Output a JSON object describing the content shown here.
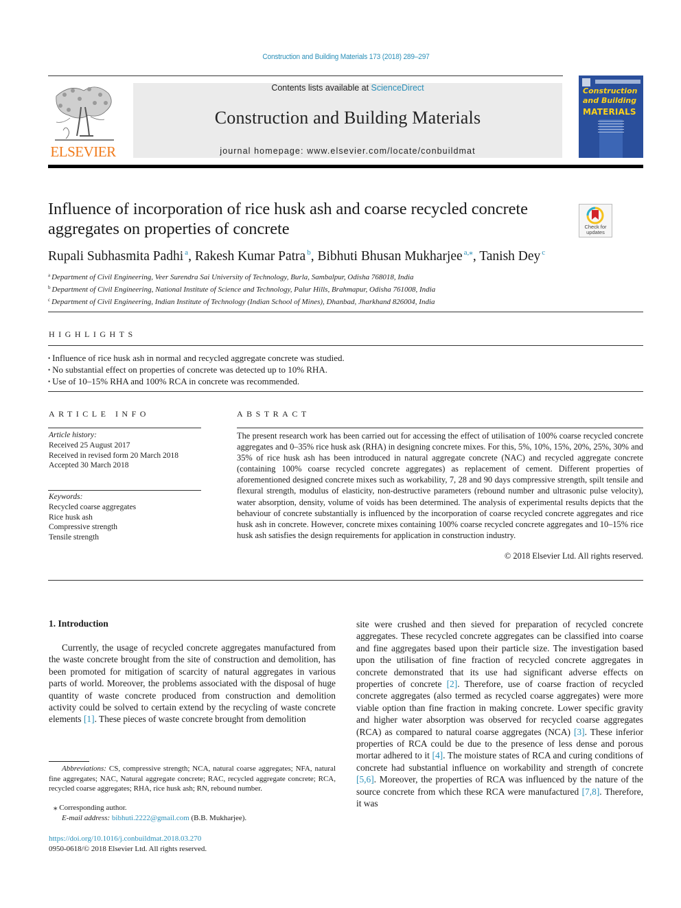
{
  "header": {
    "journal_ref": "Construction and Building Materials 173 (2018) 289–297",
    "contents_prefix": "Contents lists available at ",
    "sciencedirect_link": "ScienceDirect",
    "journal_title": "Construction and Building Materials",
    "homepage_prefix": "journal homepage: ",
    "homepage_url": "www.elsevier.com/locate/conbuildmat",
    "publisher": "ELSEVIER",
    "cover": {
      "line1": "Construction",
      "line2": "and Building",
      "line3": "MATERIALS"
    },
    "colors": {
      "link": "#2a8fb8",
      "elsevier_orange": "#f07a1a",
      "cover_blue": "#2a4f9c",
      "cover_yellow": "#ffd21a"
    }
  },
  "article": {
    "title_line1": "Influence of incorporation of rice husk ash and coarse recycled concrete",
    "title_line2": "aggregates on properties of concrete",
    "check_updates": {
      "line1": "Check for",
      "line2": "updates"
    },
    "authors": [
      {
        "name": "Rupali Subhasmita Padhi",
        "sup": "a"
      },
      {
        "name": "Rakesh Kumar Patra",
        "sup": "b"
      },
      {
        "name": "Bibhuti Bhusan Mukharjee",
        "sup": "a,⁎"
      },
      {
        "name": "Tanish Dey",
        "sup": "c"
      }
    ],
    "affiliations": [
      {
        "key": "a",
        "text": "Department of Civil Engineering, Veer Surendra Sai University of Technology, Burla, Sambalpur, Odisha 768018, India"
      },
      {
        "key": "b",
        "text": "Department of Civil Engineering, National Institute of Science and Technology, Palur Hills, Brahmapur, Odisha 761008, India"
      },
      {
        "key": "c",
        "text": "Department of Civil Engineering, Indian Institute of Technology (Indian School of Mines), Dhanbad, Jharkhand 826004, India"
      }
    ]
  },
  "highlights": {
    "heading": "HIGHLIGHTS",
    "items": [
      "Influence of rice husk ash in normal and recycled aggregate concrete was studied.",
      "No substantial effect on properties of concrete was detected up to 10% RHA.",
      "Use of 10–15% RHA and 100% RCA in concrete was recommended."
    ]
  },
  "article_info": {
    "heading": "ARTICLE INFO",
    "history_label": "Article history:",
    "history": [
      "Received 25 August 2017",
      "Received in revised form 20 March 2018",
      "Accepted 30 March 2018"
    ],
    "keywords_label": "Keywords:",
    "keywords": [
      "Recycled coarse aggregates",
      "Rice husk ash",
      "Compressive strength",
      "Tensile strength"
    ]
  },
  "abstract": {
    "heading": "ABSTRACT",
    "text": "The present research work has been carried out for accessing the effect of utilisation of 100% coarse recycled concrete aggregates and 0–35% rice husk ask (RHA) in designing concrete mixes. For this, 5%, 10%, 15%, 20%, 25%, 30% and 35% of rice husk ash has been introduced in natural aggregate concrete (NAC) and recycled aggregate concrete (containing 100% coarse recycled concrete aggregates) as replacement of cement. Different properties of aforementioned designed concrete mixes such as workability, 7, 28 and 90 days compressive strength, spilt tensile and flexural strength, modulus of elasticity, non-destructive parameters (rebound number and ultrasonic pulse velocity), water absorption, density, volume of voids has been determined. The analysis of experimental results depicts that the behaviour of concrete substantially is influenced by the incorporation of coarse recycled concrete aggregates and rice husk ash in concrete. However, concrete mixes containing 100% coarse recycled concrete aggregates and 10–15% rice husk ash satisfies the design requirements for application in construction industry.",
    "copyright": "© 2018 Elsevier Ltd. All rights reserved."
  },
  "introduction": {
    "heading": "1. Introduction",
    "col1": [
      {
        "t": "Currently, the usage of recycled concrete aggregates manufactured from the waste concrete brought from the site of construction and demolition, has been promoted for mitigation of scarcity of natural aggregates in various parts of world. Moreover, the problems associated with the disposal of huge quantity of waste concrete produced from construction and demolition activity could be solved to certain extend by the recycling of waste concrete elements "
      },
      {
        "ref": "[1]"
      },
      {
        "t": ". These pieces of waste concrete brought from demolition"
      }
    ],
    "col2": [
      {
        "t": "site were crushed and then sieved for preparation of recycled concrete aggregates. These recycled concrete aggregates can be classified into coarse and fine aggregates based upon their particle size. The investigation based upon the utilisation of fine fraction of recycled concrete aggregates in concrete demonstrated that its use had significant adverse effects on properties of concrete "
      },
      {
        "ref": "[2]"
      },
      {
        "t": ". Therefore, use of coarse fraction of recycled concrete aggregates (also termed as recycled coarse aggregates) were more viable option than fine fraction in making concrete. Lower specific gravity and higher water absorption was observed for recycled coarse aggregates (RCA) as compared to natural coarse aggregates (NCA) "
      },
      {
        "ref": "[3]"
      },
      {
        "t": ". These inferior properties of RCA could be due to the presence of less dense and porous mortar adhered to it "
      },
      {
        "ref": "[4]"
      },
      {
        "t": ". The moisture states of RCA and curing conditions of concrete had substantial influence on workability and strength of concrete "
      },
      {
        "ref": "[5,6]"
      },
      {
        "t": ". Moreover, the properties of RCA was influenced by the nature of the source concrete from which these RCA were manufactured "
      },
      {
        "ref": "[7,8]"
      },
      {
        "t": ". Therefore, it was"
      }
    ]
  },
  "footnotes": {
    "abbrev_label": "Abbreviations:",
    "abbrev_text": " CS, compressive strength; NCA, natural coarse aggregates; NFA, natural fine aggregates; NAC, Natural aggregate concrete; RAC, recycled aggregate concrete; RCA, recycled coarse aggregates; RHA, rice husk ash; RN, rebound number.",
    "corresponding": "⁎  Corresponding author.",
    "email_label": "E-mail address: ",
    "email": "bibhuti.2222@gmail.com",
    "email_suffix": " (B.B. Mukharjee).",
    "doi": "https://doi.org/10.1016/j.conbuildmat.2018.03.270",
    "issn": "0950-0618/© 2018 Elsevier Ltd. All rights reserved."
  }
}
